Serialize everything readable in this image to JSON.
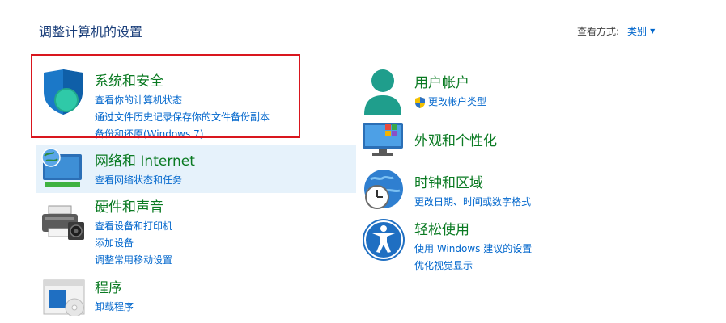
{
  "page": {
    "title": "调整计算机的设置",
    "view_by_label": "查看方式:",
    "view_by_value": "类别"
  },
  "categories": {
    "system_security": {
      "title": "系统和安全",
      "links": [
        "查看你的计算机状态",
        "通过文件历史记录保存你的文件备份副本",
        "备份和还原(Windows 7)"
      ]
    },
    "network": {
      "title": "网络和 Internet",
      "links": [
        "查看网络状态和任务"
      ]
    },
    "hardware_sound": {
      "title": "硬件和声音",
      "links": [
        "查看设备和打印机",
        "添加设备",
        "调整常用移动设置"
      ]
    },
    "programs": {
      "title": "程序",
      "links": [
        "卸载程序"
      ]
    },
    "user_accounts": {
      "title": "用户帐户",
      "links": [
        "更改帐户类型"
      ]
    },
    "appearance": {
      "title": "外观和个性化",
      "links": []
    },
    "clock_region": {
      "title": "时钟和区域",
      "links": [
        "更改日期、时间或数字格式"
      ]
    },
    "ease_of_access": {
      "title": "轻松使用",
      "links": [
        "使用 Windows 建议的设置",
        "优化视觉显示"
      ]
    }
  },
  "colors": {
    "heading_green": "#0a7a22",
    "link_blue": "#0066cc",
    "highlight_red": "#d9161e",
    "hover_blue": "#e6f2fb"
  }
}
